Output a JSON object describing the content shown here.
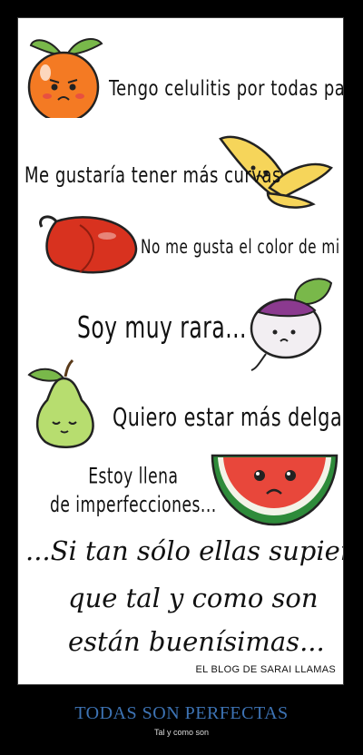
{
  "poster": {
    "lines": [
      "Tengo celulitis por todas partes",
      "Me gustaría tener más curvas",
      "No me gusta el color de mi piel",
      "Soy muy rara...",
      "Quiero estar más delgada...",
      "Estoy llena",
      "de imperfecciones..."
    ],
    "script": [
      "...Si tan sólo ellas supieran",
      "que tal y como son",
      "están buenísimas..."
    ],
    "credit": "EL BLOG DE SARAI LLAMAS"
  },
  "caption": {
    "title": "TODAS SON PERFECTAS",
    "subtitle": "Tal y como son"
  },
  "colors": {
    "background": "#000000",
    "title": "#3d73b4",
    "orange": "#f47a23",
    "banana": "#f6d55a",
    "pepper": "#d8321f",
    "turnip": "#8b3a8f",
    "pear": "#b7dd6f",
    "watermelon": "#e8473b",
    "leaf": "#79b84a"
  },
  "icons": [
    "orange-icon",
    "banana-icon",
    "pepper-icon",
    "turnip-icon",
    "pear-icon",
    "watermelon-icon"
  ]
}
